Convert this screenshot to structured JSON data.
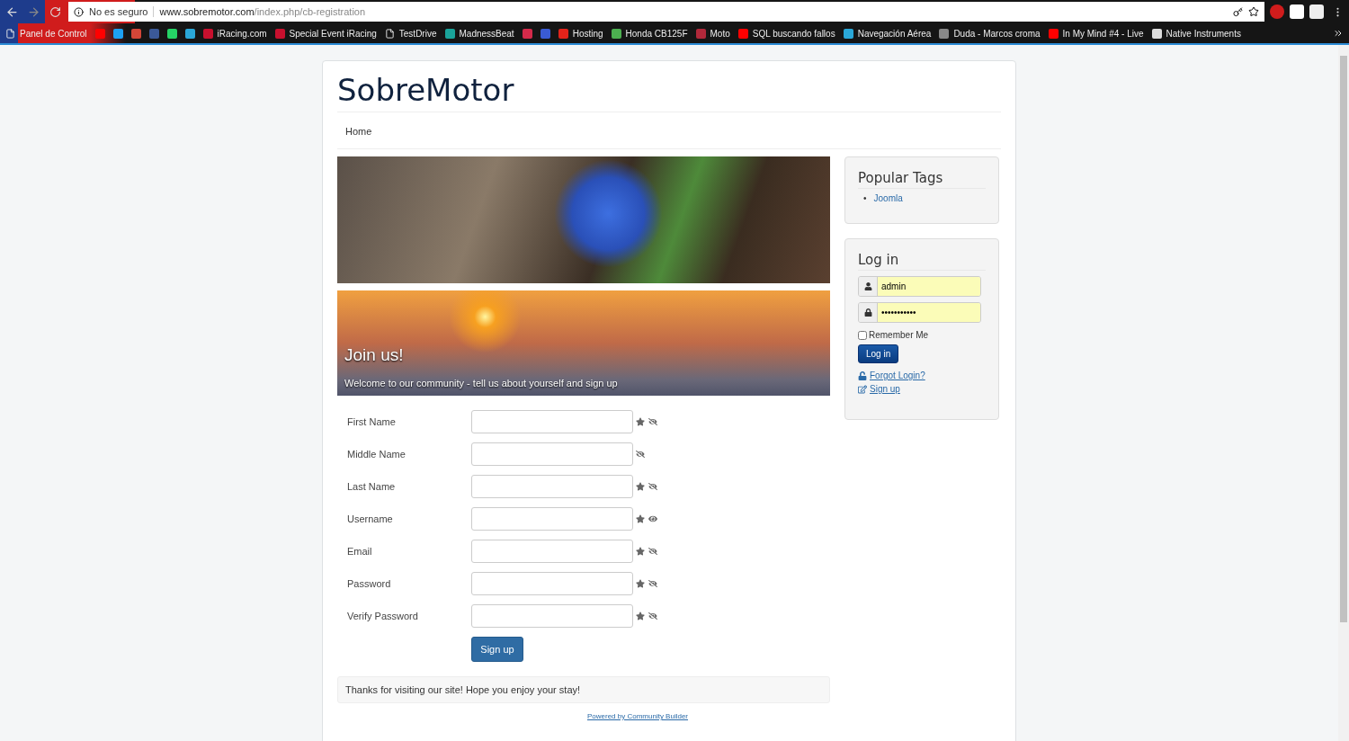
{
  "address_bar": {
    "security": "No es seguro",
    "host": "www.sobremotor.com",
    "path": "/index.php/cb-registration"
  },
  "bookmarks": [
    {
      "kind": "page",
      "label": "Panel de Control"
    },
    {
      "kind": "icon",
      "color": "#ff0000"
    },
    {
      "kind": "icon",
      "color": "#1da1f2"
    },
    {
      "kind": "icon",
      "color": "#d44638"
    },
    {
      "kind": "icon",
      "color": "#3b5998"
    },
    {
      "kind": "icon",
      "color": "#25d366"
    },
    {
      "kind": "icon",
      "color": "#2aa7d8"
    },
    {
      "kind": "site",
      "label": "iRacing.com",
      "color": "#c8102e"
    },
    {
      "kind": "site",
      "label": "Special Event iRacing",
      "color": "#c8102e"
    },
    {
      "kind": "page",
      "label": "TestDrive"
    },
    {
      "kind": "site",
      "label": "MadnessBeat",
      "color": "#1aa39a"
    },
    {
      "kind": "icon",
      "color": "#d42a4a"
    },
    {
      "kind": "icon",
      "color": "#3a5bd4"
    },
    {
      "kind": "site",
      "label": "Hosting",
      "color": "#e2231a"
    },
    {
      "kind": "site",
      "label": "Honda CB125F",
      "color": "#4caf50"
    },
    {
      "kind": "site",
      "label": "Moto",
      "color": "#b0283a"
    },
    {
      "kind": "site",
      "label": "SQL buscando fallos",
      "color": "#ff0000"
    },
    {
      "kind": "site",
      "label": "Navegación Aérea",
      "color": "#2aa7d8"
    },
    {
      "kind": "site",
      "label": "Duda - Marcos croma",
      "color": "#888888"
    },
    {
      "kind": "site",
      "label": "In My Mind #4 - Live",
      "color": "#ff0000"
    },
    {
      "kind": "site",
      "label": "Native Instruments",
      "color": "#dddddd"
    }
  ],
  "site": {
    "title": "SobreMotor",
    "nav": [
      "Home"
    ],
    "join": {
      "title": "Join us!",
      "subtitle": "Welcome to our community - tell us about yourself and sign up"
    },
    "fields": [
      {
        "label": "First Name",
        "required": true,
        "visible": false
      },
      {
        "label": "Middle Name",
        "required": false,
        "visible": false
      },
      {
        "label": "Last Name",
        "required": true,
        "visible": false
      },
      {
        "label": "Username",
        "required": true,
        "visible": true
      },
      {
        "label": "Email",
        "required": true,
        "visible": false
      },
      {
        "label": "Password",
        "required": true,
        "visible": false
      },
      {
        "label": "Verify Password",
        "required": true,
        "visible": false
      }
    ],
    "submit": "Sign up",
    "footer_message": "Thanks for visiting our site! Hope you enjoy your stay!",
    "powered": "Powered by Community Builder"
  },
  "sidebar": {
    "popular_tags": {
      "title": "Popular Tags",
      "tags": [
        {
          "marker": "•",
          "label": "Joomla"
        }
      ]
    },
    "login": {
      "title": "Log in",
      "username": "admin",
      "password": "•••••••••••",
      "remember": {
        "label": "Remember Me",
        "checked": false
      },
      "button": "Log in",
      "links": [
        {
          "kind": "forgot",
          "label": "Forgot Login?"
        },
        {
          "kind": "signup",
          "label": "Sign up"
        }
      ]
    }
  }
}
